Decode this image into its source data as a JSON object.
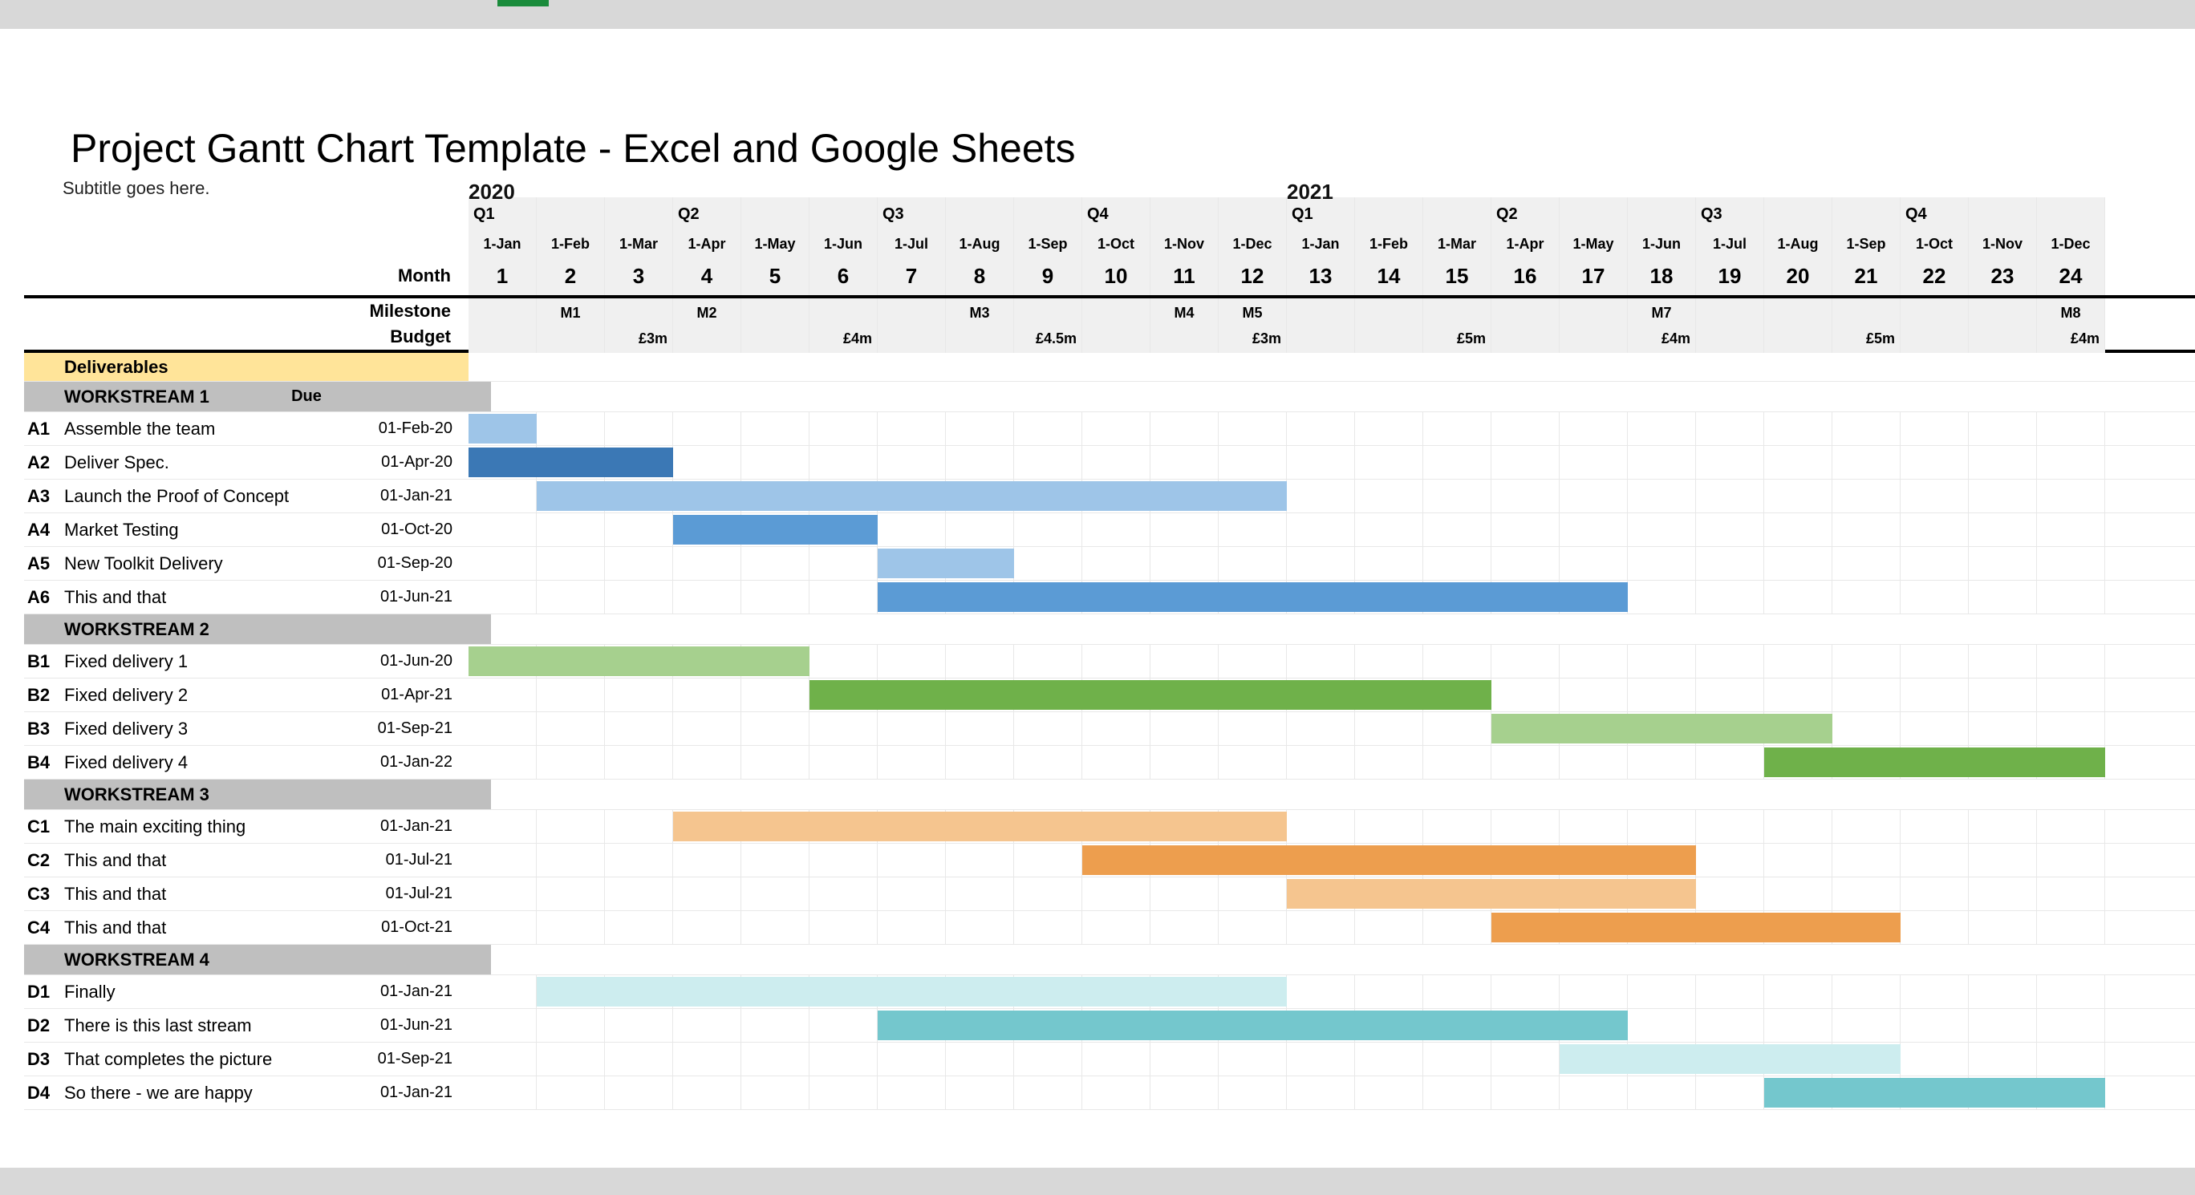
{
  "title": "Project Gantt Chart Template - Excel and Google Sheets",
  "subtitle": "Subtitle goes here.",
  "header": {
    "month_label": "Month",
    "milestone_label": "Milestone",
    "budget_label": "Budget",
    "deliverables_label": "Deliverables",
    "due_label": "Due"
  },
  "years": [
    {
      "label": "2020",
      "at_month": 1
    },
    {
      "label": "2021",
      "at_month": 13
    }
  ],
  "quarters": [
    "Q1",
    "",
    "",
    "Q2",
    "",
    "",
    "Q3",
    "",
    "",
    "Q4",
    "",
    "",
    "Q1",
    "",
    "",
    "Q2",
    "",
    "",
    "Q3",
    "",
    "",
    "Q4",
    "",
    ""
  ],
  "month_dates": [
    "1-Jan",
    "1-Feb",
    "1-Mar",
    "1-Apr",
    "1-May",
    "1-Jun",
    "1-Jul",
    "1-Aug",
    "1-Sep",
    "1-Oct",
    "1-Nov",
    "1-Dec",
    "1-Jan",
    "1-Feb",
    "1-Mar",
    "1-Apr",
    "1-May",
    "1-Jun",
    "1-Jul",
    "1-Aug",
    "1-Sep",
    "1-Oct",
    "1-Nov",
    "1-Dec"
  ],
  "month_numbers": [
    "1",
    "2",
    "3",
    "4",
    "5",
    "6",
    "7",
    "8",
    "9",
    "10",
    "11",
    "12",
    "13",
    "14",
    "15",
    "16",
    "17",
    "18",
    "19",
    "20",
    "21",
    "22",
    "23",
    "24"
  ],
  "milestones": [
    "",
    "M1",
    "",
    "M2",
    "",
    "",
    "",
    "M3",
    "",
    "",
    "M4",
    "M5",
    "",
    "",
    "",
    "",
    "",
    "M7",
    "",
    "",
    "",
    "",
    "",
    "M8"
  ],
  "budget": [
    "",
    "",
    "£3m",
    "",
    "",
    "£4m",
    "",
    "",
    "£4.5m",
    "",
    "",
    "£3m",
    "",
    "",
    "£5m",
    "",
    "",
    "£4m",
    "",
    "",
    "£5m",
    "",
    "",
    "£4m"
  ],
  "workstreams": [
    {
      "name": "WORKSTREAM 1",
      "tasks": [
        {
          "code": "A1",
          "name": "Assemble the team",
          "due": "01-Feb-20",
          "start": 1,
          "end": 2,
          "color": "c-blue-l"
        },
        {
          "code": "A2",
          "name": "Deliver Spec.",
          "due": "01-Apr-20",
          "start": 1,
          "end": 4,
          "color": "c-blue-d"
        },
        {
          "code": "A3",
          "name": "Launch the Proof of Concept",
          "due": "01-Jan-21",
          "start": 2,
          "end": 13,
          "color": "c-blue-l"
        },
        {
          "code": "A4",
          "name": "Market Testing",
          "due": "01-Oct-20",
          "start": 4,
          "end": 7,
          "color": "c-blue"
        },
        {
          "code": "A5",
          "name": "New Toolkit Delivery",
          "due": "01-Sep-20",
          "start": 7,
          "end": 9,
          "color": "c-blue-l"
        },
        {
          "code": "A6",
          "name": "This and that",
          "due": "01-Jun-21",
          "start": 7,
          "end": 18,
          "color": "c-blue"
        }
      ]
    },
    {
      "name": "WORKSTREAM 2",
      "tasks": [
        {
          "code": "B1",
          "name": "Fixed delivery 1",
          "due": "01-Jun-20",
          "start": 1,
          "end": 6,
          "color": "c-green-l"
        },
        {
          "code": "B2",
          "name": "Fixed delivery 2",
          "due": "01-Apr-21",
          "start": 6,
          "end": 16,
          "color": "c-green"
        },
        {
          "code": "B3",
          "name": "Fixed delivery 3",
          "due": "01-Sep-21",
          "start": 16,
          "end": 21,
          "color": "c-green-l"
        },
        {
          "code": "B4",
          "name": "Fixed delivery 4",
          "due": "01-Jan-22",
          "start": 20,
          "end": 25,
          "color": "c-green"
        }
      ]
    },
    {
      "name": "WORKSTREAM 3",
      "tasks": [
        {
          "code": "C1",
          "name": "The main exciting thing",
          "due": "01-Jan-21",
          "start": 4,
          "end": 13,
          "color": "c-orange-l"
        },
        {
          "code": "C2",
          "name": "This and that",
          "due": "01-Jul-21",
          "start": 10,
          "end": 19,
          "color": "c-orange"
        },
        {
          "code": "C3",
          "name": "This and that",
          "due": "01-Jul-21",
          "start": 13,
          "end": 19,
          "color": "c-orange-l"
        },
        {
          "code": "C4",
          "name": "This and that",
          "due": "01-Oct-21",
          "start": 16,
          "end": 22,
          "color": "c-orange"
        }
      ]
    },
    {
      "name": "WORKSTREAM 4",
      "tasks": [
        {
          "code": "D1",
          "name": "Finally",
          "due": "01-Jan-21",
          "start": 2,
          "end": 13,
          "color": "c-teal-vl"
        },
        {
          "code": "D2",
          "name": "There is this last stream",
          "due": "01-Jun-21",
          "start": 7,
          "end": 18,
          "color": "c-teal"
        },
        {
          "code": "D3",
          "name": "That completes the picture",
          "due": "01-Sep-21",
          "start": 17,
          "end": 22,
          "color": "c-teal-vl"
        },
        {
          "code": "D4",
          "name": "So there - we are happy",
          "due": "01-Jan-21",
          "start": 20,
          "end": 25,
          "color": "c-teal"
        }
      ]
    }
  ],
  "chart_data": {
    "type": "bar",
    "title": "Project Gantt Chart Template - Excel and Google Sheets",
    "subtitle": "Subtitle goes here.",
    "xlabel": "Month",
    "x_range": [
      1,
      24
    ],
    "x_tick_labels": [
      "1-Jan",
      "1-Feb",
      "1-Mar",
      "1-Apr",
      "1-May",
      "1-Jun",
      "1-Jul",
      "1-Aug",
      "1-Sep",
      "1-Oct",
      "1-Nov",
      "1-Dec",
      "1-Jan",
      "1-Feb",
      "1-Mar",
      "1-Apr",
      "1-May",
      "1-Jun",
      "1-Jul",
      "1-Aug",
      "1-Sep",
      "1-Oct",
      "1-Nov",
      "1-Dec"
    ],
    "milestones": [
      {
        "month": 2,
        "label": "M1"
      },
      {
        "month": 4,
        "label": "M2"
      },
      {
        "month": 8,
        "label": "M3"
      },
      {
        "month": 11,
        "label": "M4"
      },
      {
        "month": 12,
        "label": "M5"
      },
      {
        "month": 18,
        "label": "M7"
      },
      {
        "month": 24,
        "label": "M8"
      }
    ],
    "budget_per_quarter": [
      {
        "quarter": "2020 Q1",
        "amount_m": 3
      },
      {
        "quarter": "2020 Q2",
        "amount_m": 4
      },
      {
        "quarter": "2020 Q3",
        "amount_m": 4.5
      },
      {
        "quarter": "2020 Q4",
        "amount_m": 3
      },
      {
        "quarter": "2021 Q1",
        "amount_m": 5
      },
      {
        "quarter": "2021 Q2",
        "amount_m": 4
      },
      {
        "quarter": "2021 Q3",
        "amount_m": 5
      },
      {
        "quarter": "2021 Q4",
        "amount_m": 4
      }
    ],
    "series": [
      {
        "group": "WORKSTREAM 1",
        "code": "A1",
        "name": "Assemble the team",
        "due": "01-Feb-20",
        "start": 1,
        "end": 2
      },
      {
        "group": "WORKSTREAM 1",
        "code": "A2",
        "name": "Deliver Spec.",
        "due": "01-Apr-20",
        "start": 1,
        "end": 4
      },
      {
        "group": "WORKSTREAM 1",
        "code": "A3",
        "name": "Launch the Proof of Concept",
        "due": "01-Jan-21",
        "start": 2,
        "end": 13
      },
      {
        "group": "WORKSTREAM 1",
        "code": "A4",
        "name": "Market Testing",
        "due": "01-Oct-20",
        "start": 4,
        "end": 7
      },
      {
        "group": "WORKSTREAM 1",
        "code": "A5",
        "name": "New Toolkit Delivery",
        "due": "01-Sep-20",
        "start": 7,
        "end": 9
      },
      {
        "group": "WORKSTREAM 1",
        "code": "A6",
        "name": "This and that",
        "due": "01-Jun-21",
        "start": 7,
        "end": 18
      },
      {
        "group": "WORKSTREAM 2",
        "code": "B1",
        "name": "Fixed delivery 1",
        "due": "01-Jun-20",
        "start": 1,
        "end": 6
      },
      {
        "group": "WORKSTREAM 2",
        "code": "B2",
        "name": "Fixed delivery 2",
        "due": "01-Apr-21",
        "start": 6,
        "end": 16
      },
      {
        "group": "WORKSTREAM 2",
        "code": "B3",
        "name": "Fixed delivery 3",
        "due": "01-Sep-21",
        "start": 16,
        "end": 21
      },
      {
        "group": "WORKSTREAM 2",
        "code": "B4",
        "name": "Fixed delivery 4",
        "due": "01-Jan-22",
        "start": 20,
        "end": 25
      },
      {
        "group": "WORKSTREAM 3",
        "code": "C1",
        "name": "The main exciting thing",
        "due": "01-Jan-21",
        "start": 4,
        "end": 13
      },
      {
        "group": "WORKSTREAM 3",
        "code": "C2",
        "name": "This and that",
        "due": "01-Jul-21",
        "start": 10,
        "end": 19
      },
      {
        "group": "WORKSTREAM 3",
        "code": "C3",
        "name": "This and that",
        "due": "01-Jul-21",
        "start": 13,
        "end": 19
      },
      {
        "group": "WORKSTREAM 3",
        "code": "C4",
        "name": "This and that",
        "due": "01-Oct-21",
        "start": 16,
        "end": 22
      },
      {
        "group": "WORKSTREAM 4",
        "code": "D1",
        "name": "Finally",
        "due": "01-Jan-21",
        "start": 2,
        "end": 13
      },
      {
        "group": "WORKSTREAM 4",
        "code": "D2",
        "name": "There is this last stream",
        "due": "01-Jun-21",
        "start": 7,
        "end": 18
      },
      {
        "group": "WORKSTREAM 4",
        "code": "D3",
        "name": "That completes the picture",
        "due": "01-Sep-21",
        "start": 17,
        "end": 22
      },
      {
        "group": "WORKSTREAM 4",
        "code": "D4",
        "name": "So there - we are happy",
        "due": "01-Jan-21",
        "start": 20,
        "end": 25
      }
    ]
  }
}
